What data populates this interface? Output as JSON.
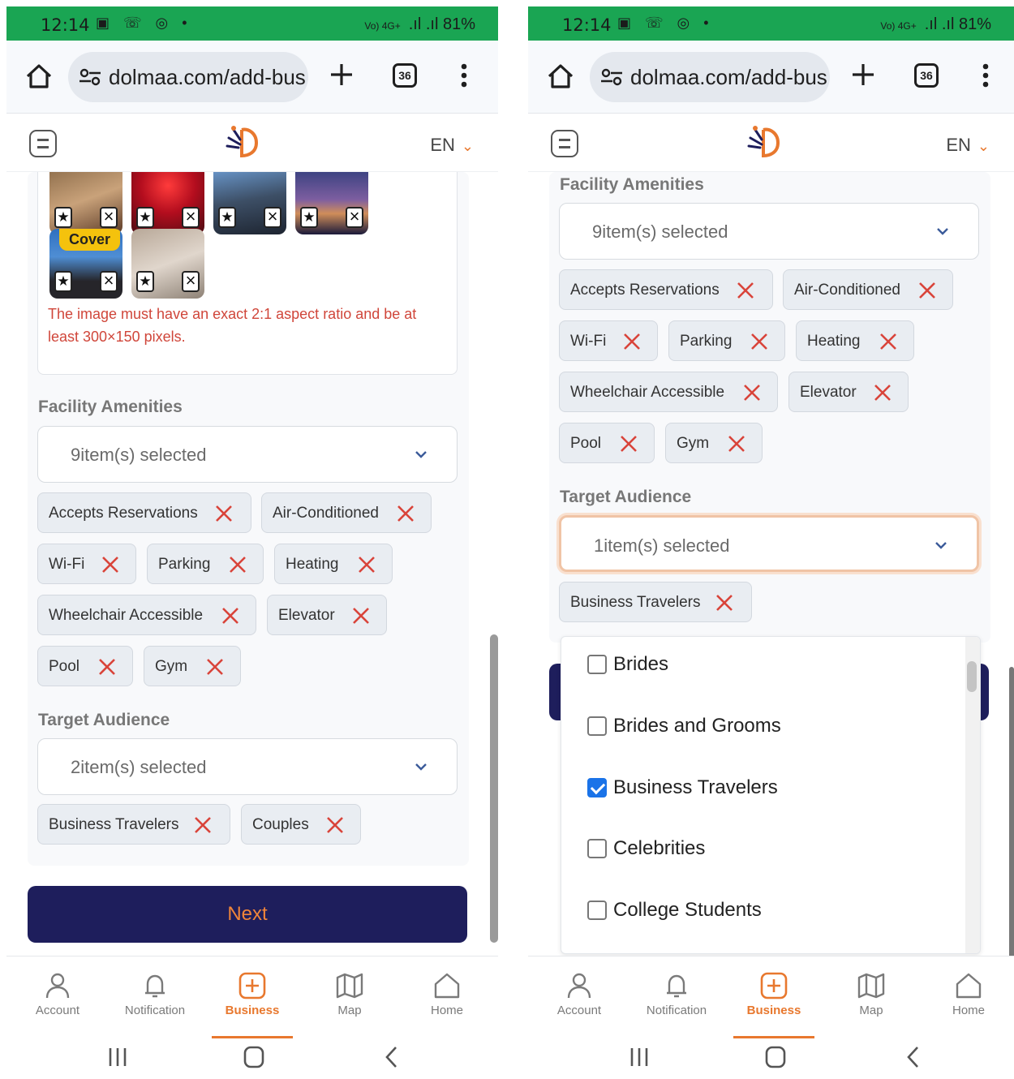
{
  "status": {
    "time": "12:14",
    "battery": "81%",
    "left_icons": "▣ ☏ ◎ •",
    "network": "Vo) 4G+"
  },
  "browser": {
    "url": "dolmaa.com/add-bus",
    "tab_count": "36"
  },
  "header": {
    "lang": "EN"
  },
  "left": {
    "cover_label": "Cover",
    "image_error": "The image must have an exact 2:1 aspect ratio and be at least 300×150 pixels.",
    "facility": {
      "title": "Facility Amenities",
      "selected": "9item(s) selected",
      "chips": [
        "Accepts Reservations",
        "Air-Conditioned",
        "Wi-Fi",
        "Parking",
        "Heating",
        "Wheelchair Accessible",
        "Elevator",
        "Pool",
        "Gym"
      ]
    },
    "audience": {
      "title": "Target Audience",
      "selected": "2item(s) selected",
      "chips": [
        "Business Travelers",
        "Couples"
      ]
    },
    "next_label": "Next"
  },
  "right": {
    "facility": {
      "title": "Facility Amenities",
      "selected": "9item(s) selected",
      "chips": [
        "Accepts Reservations",
        "Air-Conditioned",
        "Wi-Fi",
        "Parking",
        "Heating",
        "Wheelchair Accessible",
        "Elevator",
        "Pool",
        "Gym"
      ]
    },
    "audience": {
      "title": "Target Audience",
      "selected": "1item(s) selected",
      "chips": [
        "Business Travelers"
      ]
    },
    "options": [
      {
        "label": "Brides",
        "checked": false
      },
      {
        "label": "Brides and Grooms",
        "checked": false
      },
      {
        "label": "Business Travelers",
        "checked": true
      },
      {
        "label": "Celebrities",
        "checked": false
      },
      {
        "label": "College Students",
        "checked": false
      }
    ]
  },
  "nav": {
    "items": [
      {
        "label": "Account",
        "icon": "person-icon"
      },
      {
        "label": "Notification",
        "icon": "bell-icon"
      },
      {
        "label": "Business",
        "icon": "plus-square-icon"
      },
      {
        "label": "Map",
        "icon": "map-icon"
      },
      {
        "label": "Home",
        "icon": "home-icon"
      }
    ],
    "active": "Business"
  },
  "colors": {
    "accent": "#e8782e",
    "primary": "#1e1e5c",
    "error": "#d0463a",
    "chip_x": "#d9443a",
    "status_bar": "#1aa553"
  }
}
